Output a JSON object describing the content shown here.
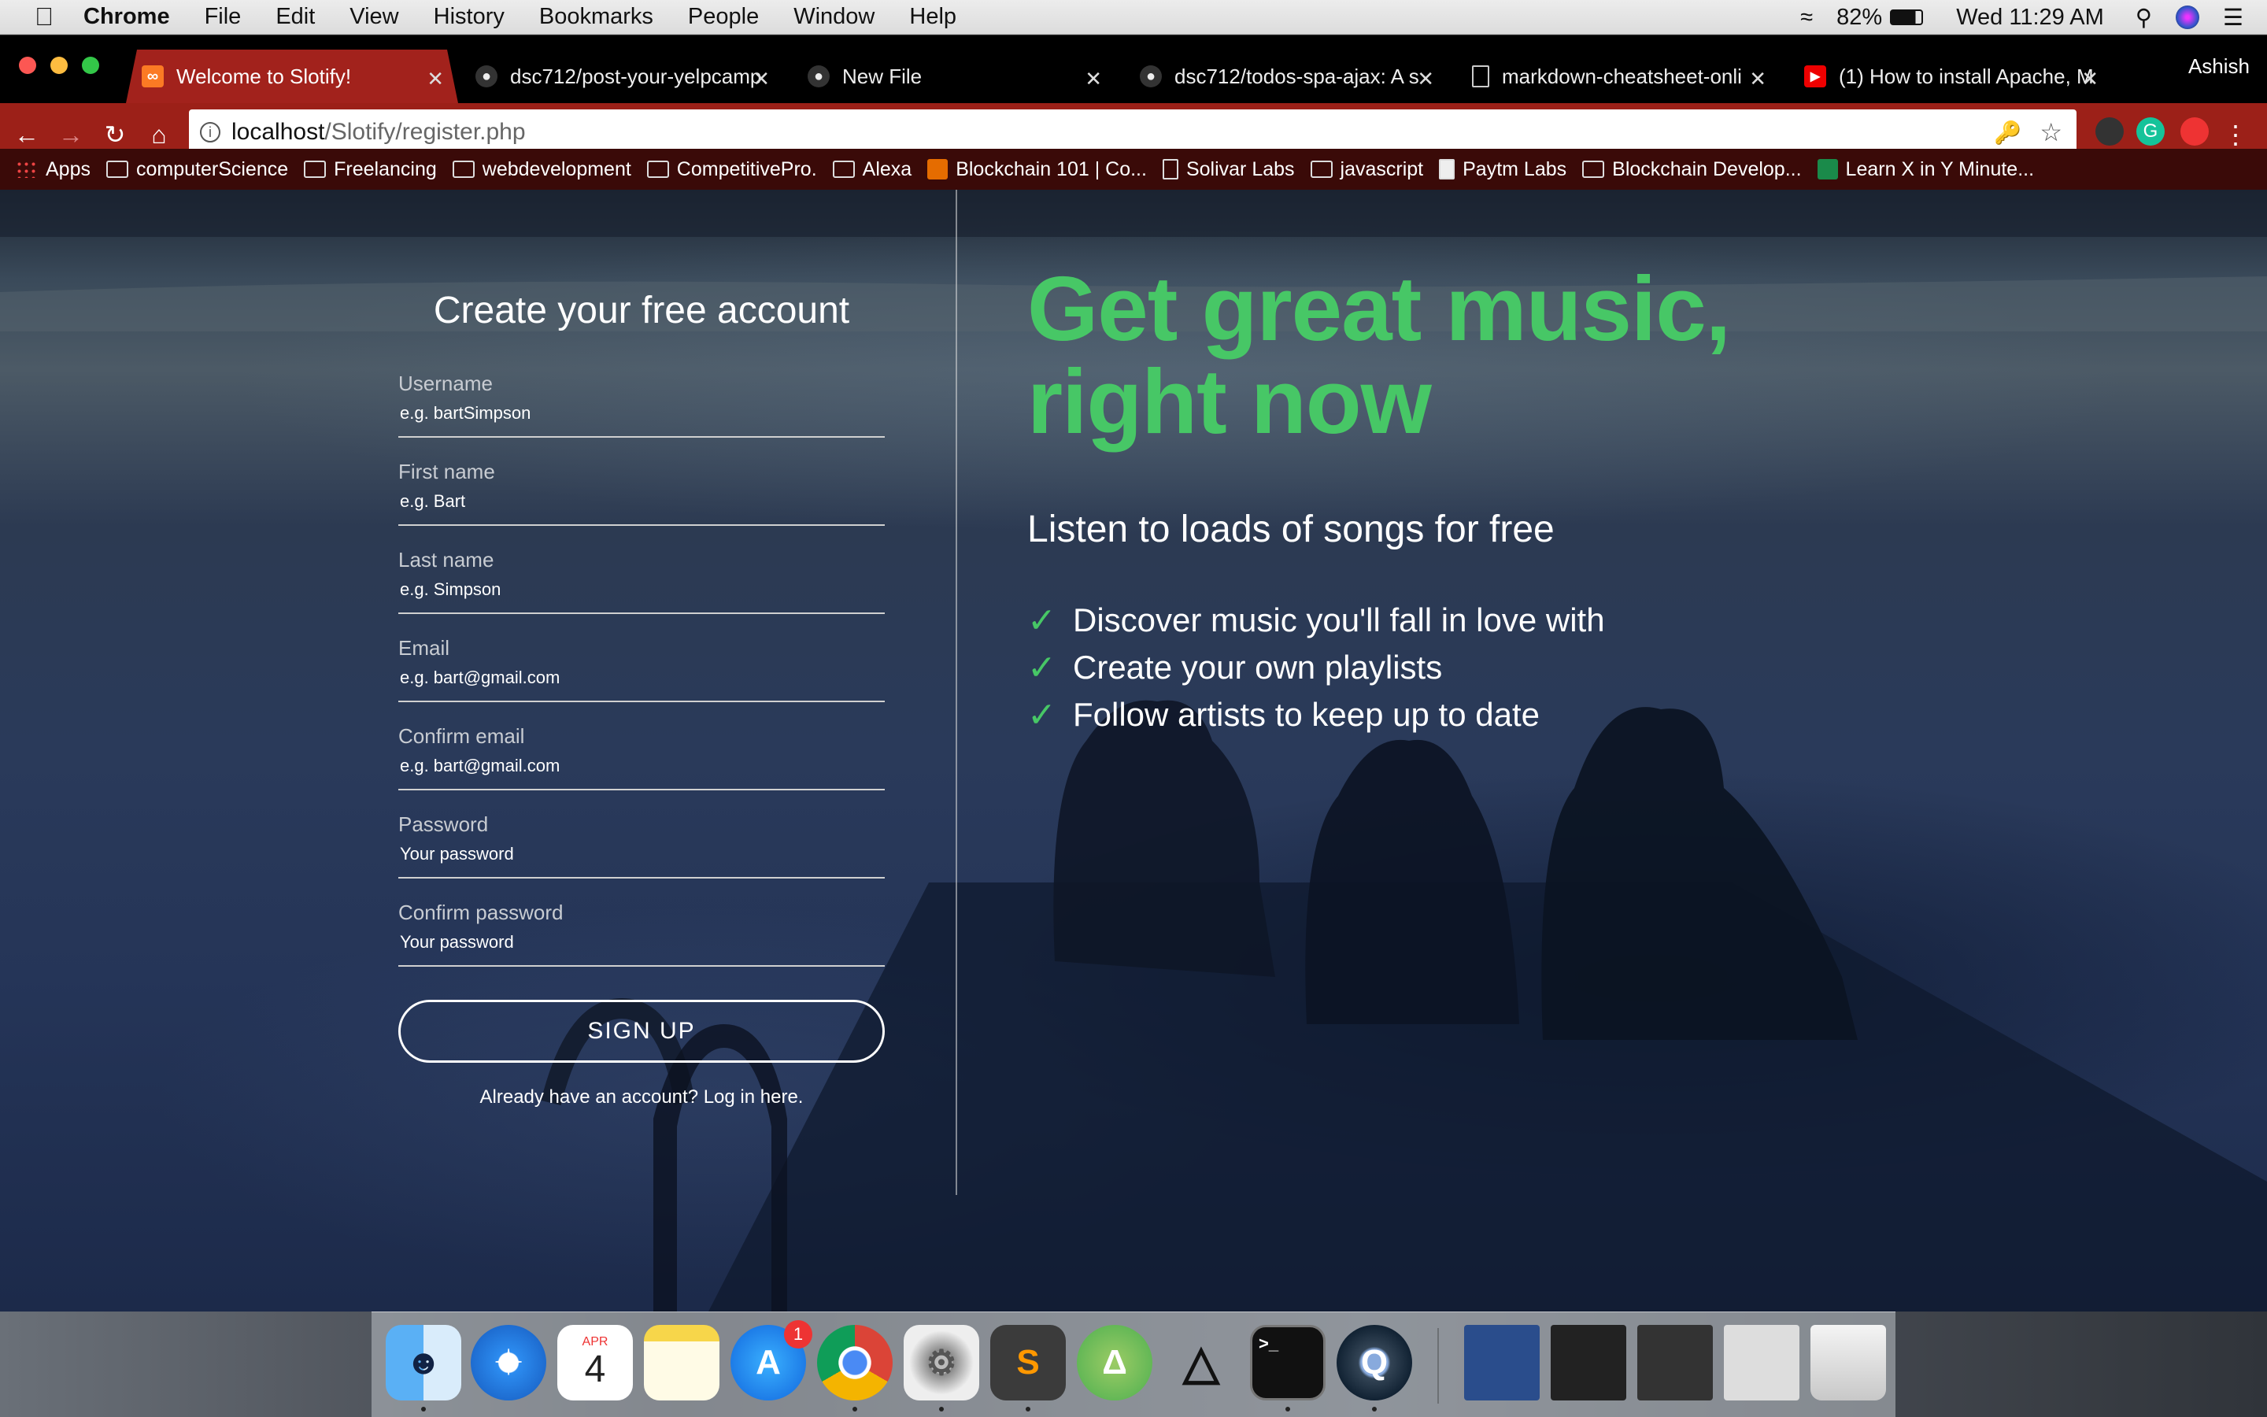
{
  "menubar": {
    "apple": "",
    "items": [
      "Chrome",
      "File",
      "Edit",
      "View",
      "History",
      "Bookmarks",
      "People",
      "Window",
      "Help"
    ],
    "battery": "82%",
    "clock": "Wed 11:29 AM"
  },
  "browser": {
    "profile": "Ashish",
    "tabs": [
      {
        "title": "Welcome to Slotify!",
        "icon": "xampp-icon"
      },
      {
        "title": "dsc712/post-your-yelpcamp",
        "icon": "github-icon"
      },
      {
        "title": "New File",
        "icon": "github-icon"
      },
      {
        "title": "dsc712/todos-spa-ajax: A s",
        "icon": "github-icon"
      },
      {
        "title": "markdown-cheatsheet-onli",
        "icon": "file-icon"
      },
      {
        "title": "(1) How to install Apache, M",
        "icon": "youtube-icon"
      }
    ],
    "url_host": "localhost",
    "url_path": "/Slotify/register.php",
    "bookmarks": [
      {
        "label": "Apps",
        "icon": "apps-icon"
      },
      {
        "label": "computerScience",
        "icon": "folder-icon"
      },
      {
        "label": "Freelancing",
        "icon": "folder-icon"
      },
      {
        "label": "webdevelopment",
        "icon": "folder-icon"
      },
      {
        "label": "CompetitivePro.",
        "icon": "folder-icon"
      },
      {
        "label": "Alexa",
        "icon": "folder-icon"
      },
      {
        "label": "Blockchain 101 | Co...",
        "icon": "blockchain-icon"
      },
      {
        "label": "Solivar Labs",
        "icon": "file-icon"
      },
      {
        "label": "javascript",
        "icon": "folder-icon"
      },
      {
        "label": "Paytm Labs",
        "icon": "paytm-icon"
      },
      {
        "label": "Blockchain Develop...",
        "icon": "folder-icon"
      },
      {
        "label": "Learn X in Y Minute...",
        "icon": "learnx-icon"
      }
    ]
  },
  "form": {
    "title": "Create your free account",
    "fields": [
      {
        "label": "Username",
        "placeholder": "e.g. bartSimpson"
      },
      {
        "label": "First name",
        "placeholder": "e.g. Bart"
      },
      {
        "label": "Last name",
        "placeholder": "e.g. Simpson"
      },
      {
        "label": "Email",
        "placeholder": "e.g. bart@gmail.com"
      },
      {
        "label": "Confirm email",
        "placeholder": "e.g. bart@gmail.com"
      },
      {
        "label": "Password",
        "placeholder": "Your password"
      },
      {
        "label": "Confirm password",
        "placeholder": "Your password"
      }
    ],
    "signup_label": "SIGN UP",
    "login_text": "Already have an account? Log in here."
  },
  "hero": {
    "headline_1": "Get great music,",
    "headline_2": "right now",
    "subtitle": "Listen to loads of songs for free",
    "features": [
      "Discover music you'll fall in love with",
      "Create your own playlists",
      "Follow artists to keep up to date"
    ],
    "accent_color": "#47c766"
  },
  "dock": {
    "calendar_month": "APR",
    "calendar_day": "4",
    "appstore_badge": "1",
    "terminal_prompt": ">_"
  }
}
